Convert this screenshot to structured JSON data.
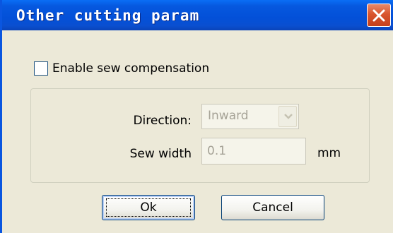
{
  "window": {
    "title": "Other cutting param",
    "close_icon": "close-icon"
  },
  "options": {
    "enable_sew_compensation_label": "Enable sew compensation",
    "enable_sew_compensation_checked": false
  },
  "fields": {
    "direction_label": "Direction:",
    "direction_value": "Inward",
    "sew_width_label": "Sew width",
    "sew_width_value": "0.1",
    "sew_width_unit": "mm"
  },
  "buttons": {
    "ok_label": "Ok",
    "cancel_label": "Cancel"
  },
  "colors": {
    "titlebar": "#0350d8",
    "close_button": "#d9552e",
    "dialog_background": "#ece9d8",
    "disabled_text": "#a6a397"
  }
}
